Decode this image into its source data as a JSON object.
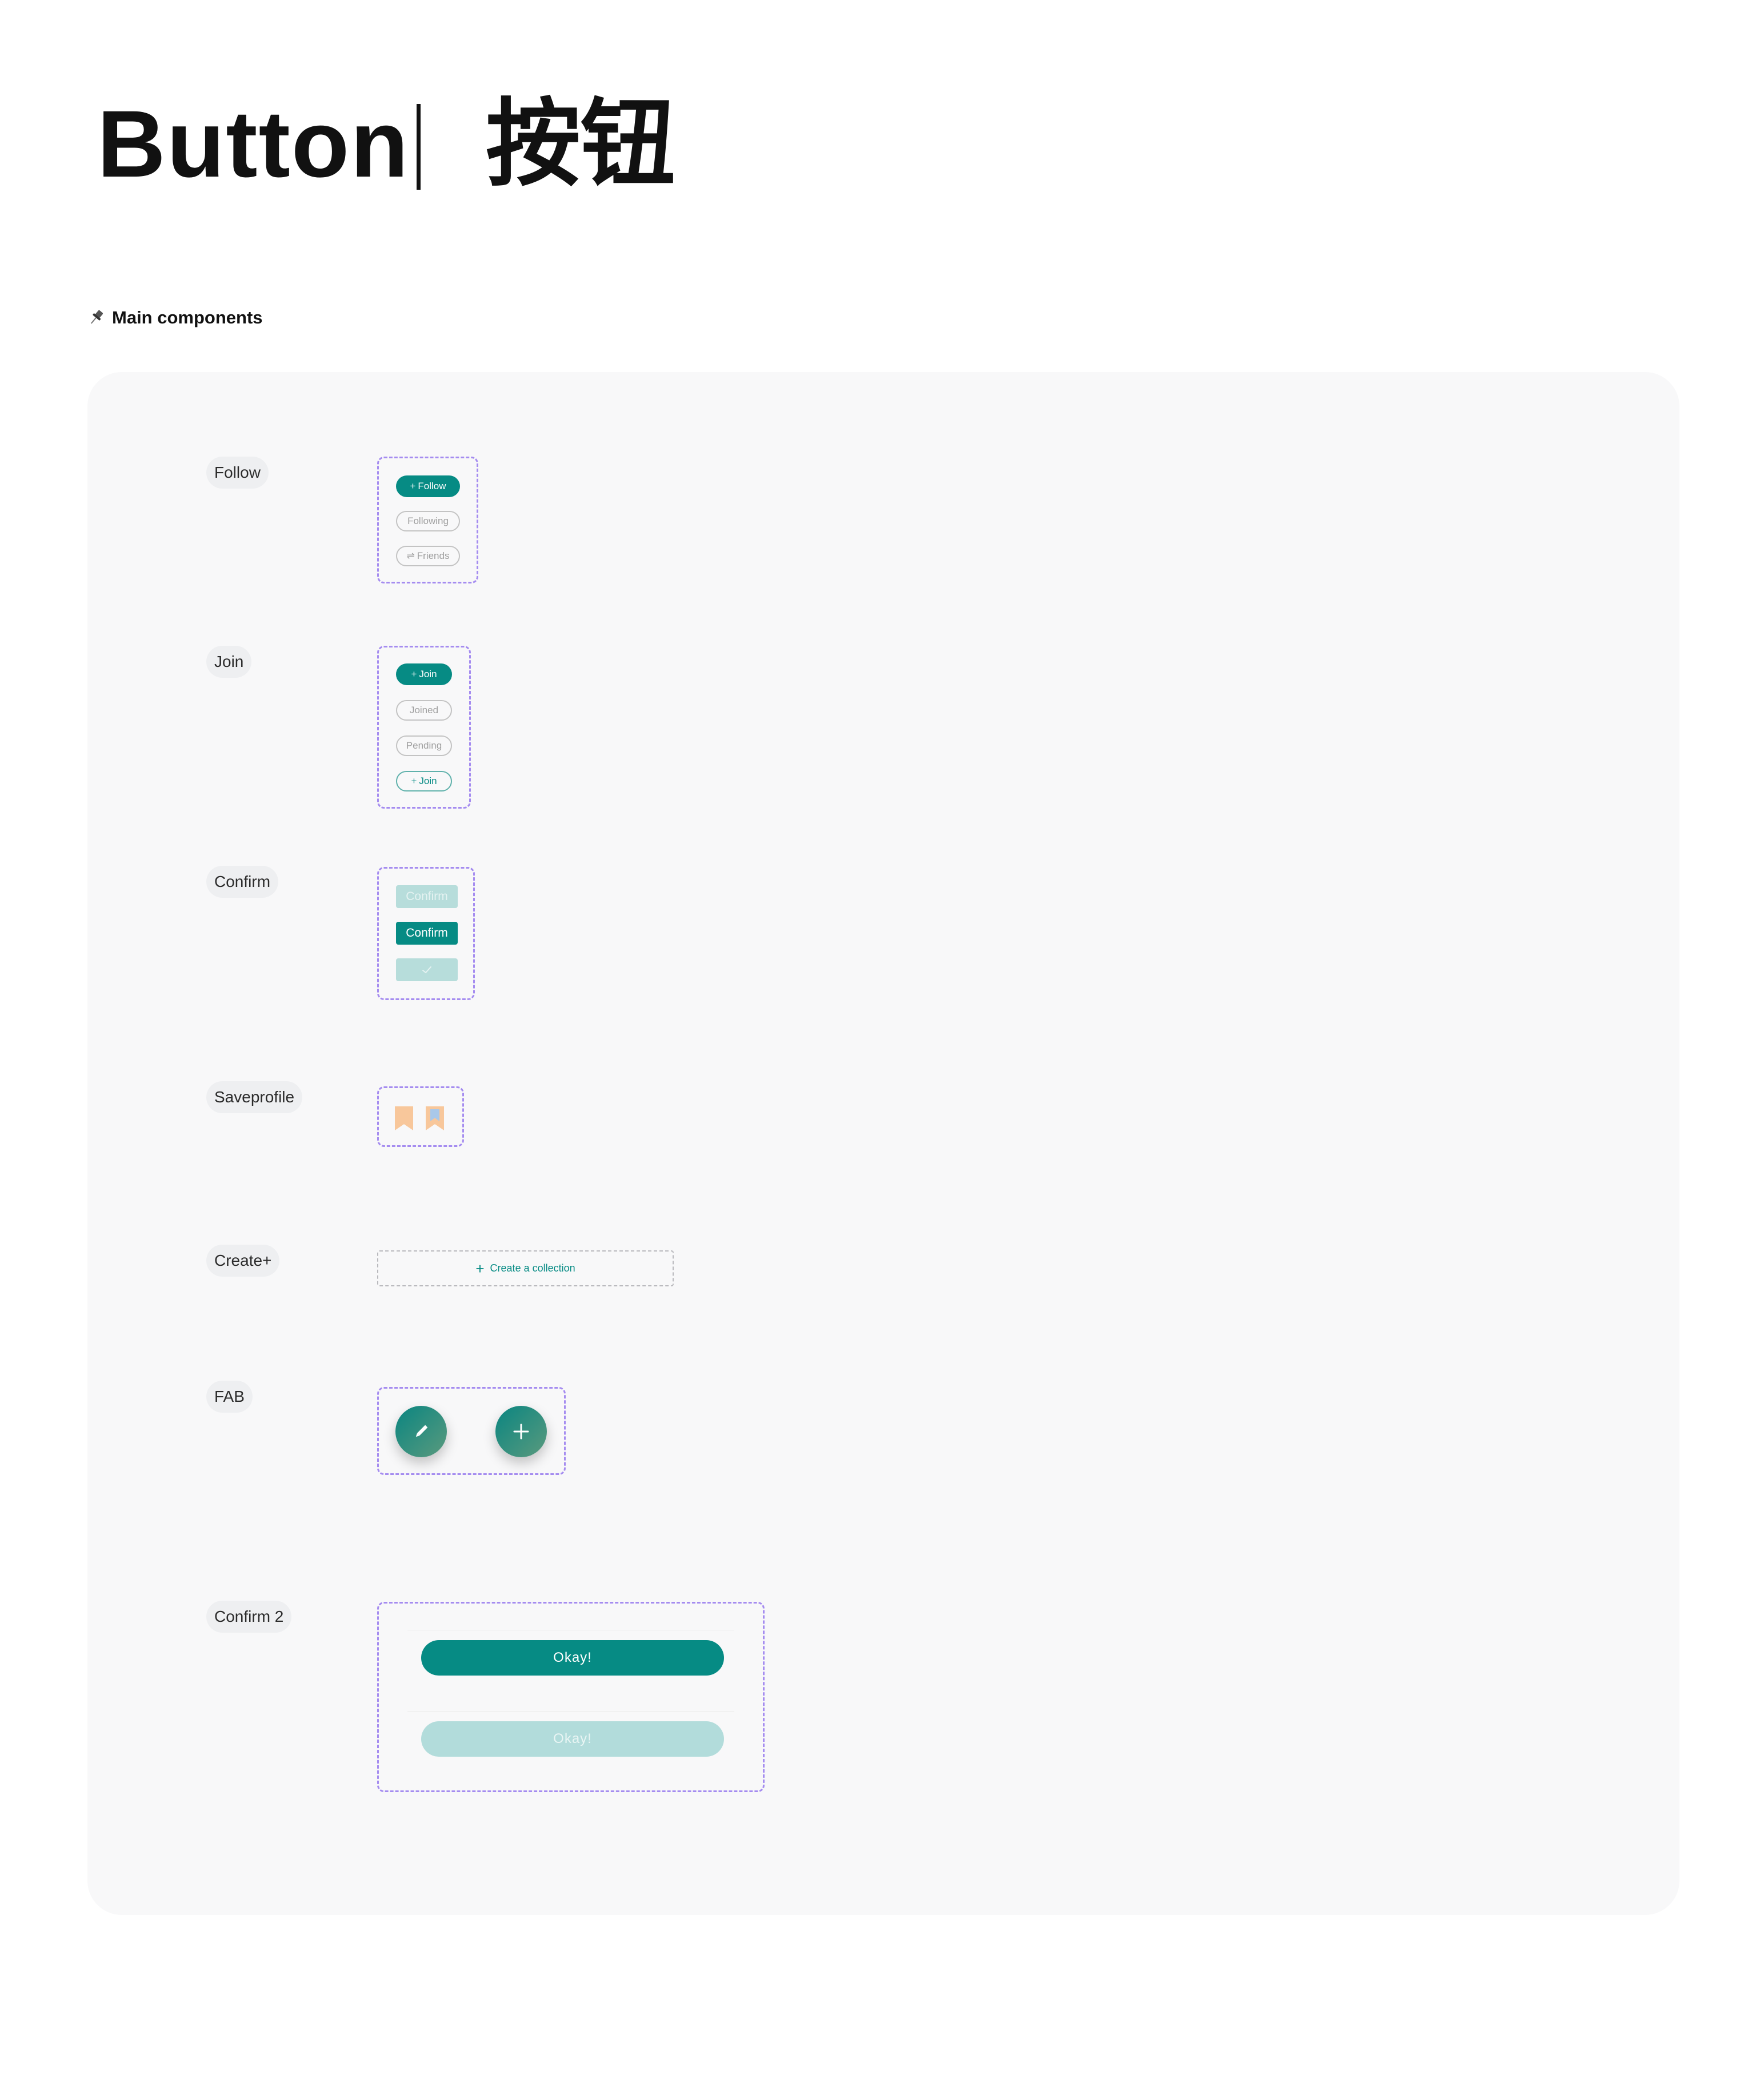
{
  "header": {
    "title_en": "Button",
    "title_zh": "按钮"
  },
  "section": {
    "icon": "pushpin-icon",
    "label": "Main components"
  },
  "rows": {
    "follow": {
      "label": "Follow",
      "buttons": {
        "follow": "Follow",
        "following": "Following",
        "friends": "Friends"
      }
    },
    "join": {
      "label": "Join",
      "buttons": {
        "join": "Join",
        "joined": "Joined",
        "pending": "Pending",
        "join_outline": "Join"
      }
    },
    "confirm": {
      "label": "Confirm",
      "buttons": {
        "disabled": "Confirm",
        "active": "Confirm",
        "loading_icon": "check-icon"
      }
    },
    "saveprofile": {
      "label": "Saveprofile",
      "icons": [
        "bookmark-icon",
        "bookmark-saved-icon"
      ]
    },
    "create": {
      "label": "Create+",
      "button": "Create a collection"
    },
    "fab": {
      "label": "FAB",
      "icons": [
        "pencil-icon",
        "plus-icon"
      ]
    },
    "confirm2": {
      "label": "Confirm 2",
      "buttons": {
        "active": "Okay!",
        "disabled": "Okay!"
      }
    }
  },
  "colors": {
    "teal": "#068b84",
    "teal_light": "#b7dddb",
    "dashed_border": "#a58cf0",
    "panel_bg": "#f8f8f9",
    "bookmark": "#f8c79b"
  }
}
